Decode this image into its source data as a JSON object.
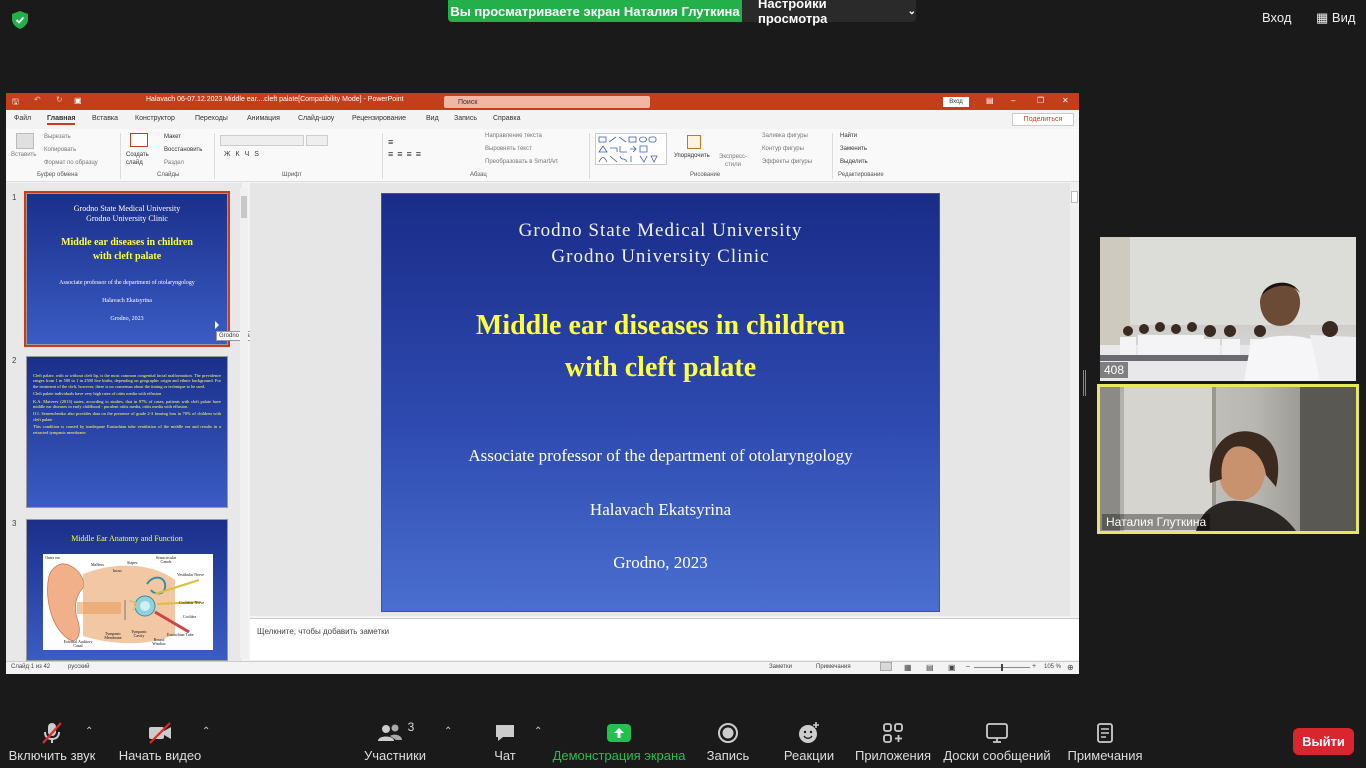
{
  "zoom": {
    "sharing_banner": "Вы просматриваете экран Наталия Глуткина",
    "view_settings": "Настройки просмотра",
    "exit_fullscreen": "Вход",
    "view": "Вид",
    "colors": {
      "green": "#23b04a",
      "leave": "#d9262e"
    }
  },
  "ppt": {
    "title": "Halavach 06-07.12.2023 Middle ear....cleft palate[Compatibility Mode] - PowerPoint",
    "search_placeholder": "Поиск",
    "login": "Вход",
    "share": "Поделиться",
    "tabs": [
      "Файл",
      "Главная",
      "Вставка",
      "Конструктор",
      "Переходы",
      "Анимация",
      "Слайд-шоу",
      "Рецензирование",
      "Вид",
      "Запись",
      "Справка"
    ],
    "ribbon": {
      "paste": "Вставить",
      "cut": "Вырезать",
      "copy": "Копировать",
      "format_painter": "Формат по образцу",
      "clipboard": "Буфер обмена",
      "new_slide": "Создать слайд",
      "layout": "Макет",
      "reset": "Восстановить",
      "section": "Раздел",
      "slides": "Слайды",
      "font": "Шрифт",
      "text_direction": "Направление текста",
      "align_text": "Выровнять текст",
      "smartart": "Преобразовать в SmartArt",
      "paragraph": "Абзац",
      "arrange": "Упорядочить",
      "quick_styles": "Экспресс-стили",
      "shape_fill": "Заливка фигуры",
      "shape_outline": "Контур фигуры",
      "shape_effects": "Эффекты фигуры",
      "drawing": "Рисование",
      "find": "Найти",
      "replace": "Заменить",
      "select": "Выделить",
      "editing": "Редактирование"
    },
    "thumbnails": {
      "s1": {
        "num": "1",
        "uni1": "Grodno State Medical University",
        "uni2": "Grodno University Clinic",
        "title1": "Middle ear diseases in children",
        "title2": "with cleft palate",
        "assoc": "Associate  professor of  the  department of otolaryngology",
        "author": "Halavach Ekatsyrina",
        "city": "Grodno, 2023"
      },
      "s2": {
        "num": "2",
        "p1": "Cleft palate, with or without cleft lip, is the most common congenital facial malformation. The prevalence ranges from 1 in 500 to 1 in 2500 live births, depending on geographic origin and ethnic background. For the treatment of the cleft, however, there is no consensus about the timing or technique to be used.",
        "p2": "Cleft palate individuals have very high rates of otitis media with effusion",
        "p3": "K.A. Matveev (2013) states, according to studies, that in 97% of cases, patients with cleft palate have middle ear diseases in early childhood - purulent otitis media, otitis media with effusion.",
        "p4": "O.I. Semenchenko also provides data on the presence of grade 2-3 hearing loss in 70% of children with cleft palate",
        "p5": "This condition is caused by inadequate Eustachian tube ventilation of the middle ear and results in a retracted tympanic membrane."
      },
      "s3": {
        "num": "3",
        "title": "Middle Ear Anatomy and Function",
        "labels": [
          "Outer ear",
          "Malleus",
          "Incus",
          "Stapes",
          "Semicircular Canals",
          "Vestibular Nerve",
          "Cochlear Nerve",
          "Cochlea",
          "Eustachian Tube",
          "Round Window",
          "Tympanic Cavity",
          "Tympanic Membrane",
          "External Auditory Canal"
        ]
      },
      "tooltip": "Grodno State Medical Universit..."
    },
    "slide": {
      "uni1": "Grodno State Medical University",
      "uni2": "Grodno University Clinic",
      "title1": "Middle ear diseases in children",
      "title2": "with cleft palate",
      "assoc": "Associate  professor of  the  department of otolaryngology",
      "author": "Halavach Ekatsyrina",
      "city": "Grodno, 2023"
    },
    "notes_placeholder": "Щелкните, чтобы добавить заметки",
    "status": {
      "slide_info": "Слайд 1 из 42",
      "language": "русский",
      "notes": "Заметки",
      "comments": "Примечания",
      "zoom": "105 %"
    }
  },
  "videos": {
    "room_label": "408",
    "speaker_name": "Наталия Глуткина"
  },
  "toolbar": {
    "mute": "Включить звук",
    "video": "Начать видео",
    "participants": "Участники",
    "participants_count": "3",
    "chat": "Чат",
    "share_screen": "Демонстрация экрана",
    "record": "Запись",
    "reactions": "Реакции",
    "apps": "Приложения",
    "whiteboards": "Доски сообщений",
    "notes": "Примечания",
    "leave": "Выйти"
  }
}
